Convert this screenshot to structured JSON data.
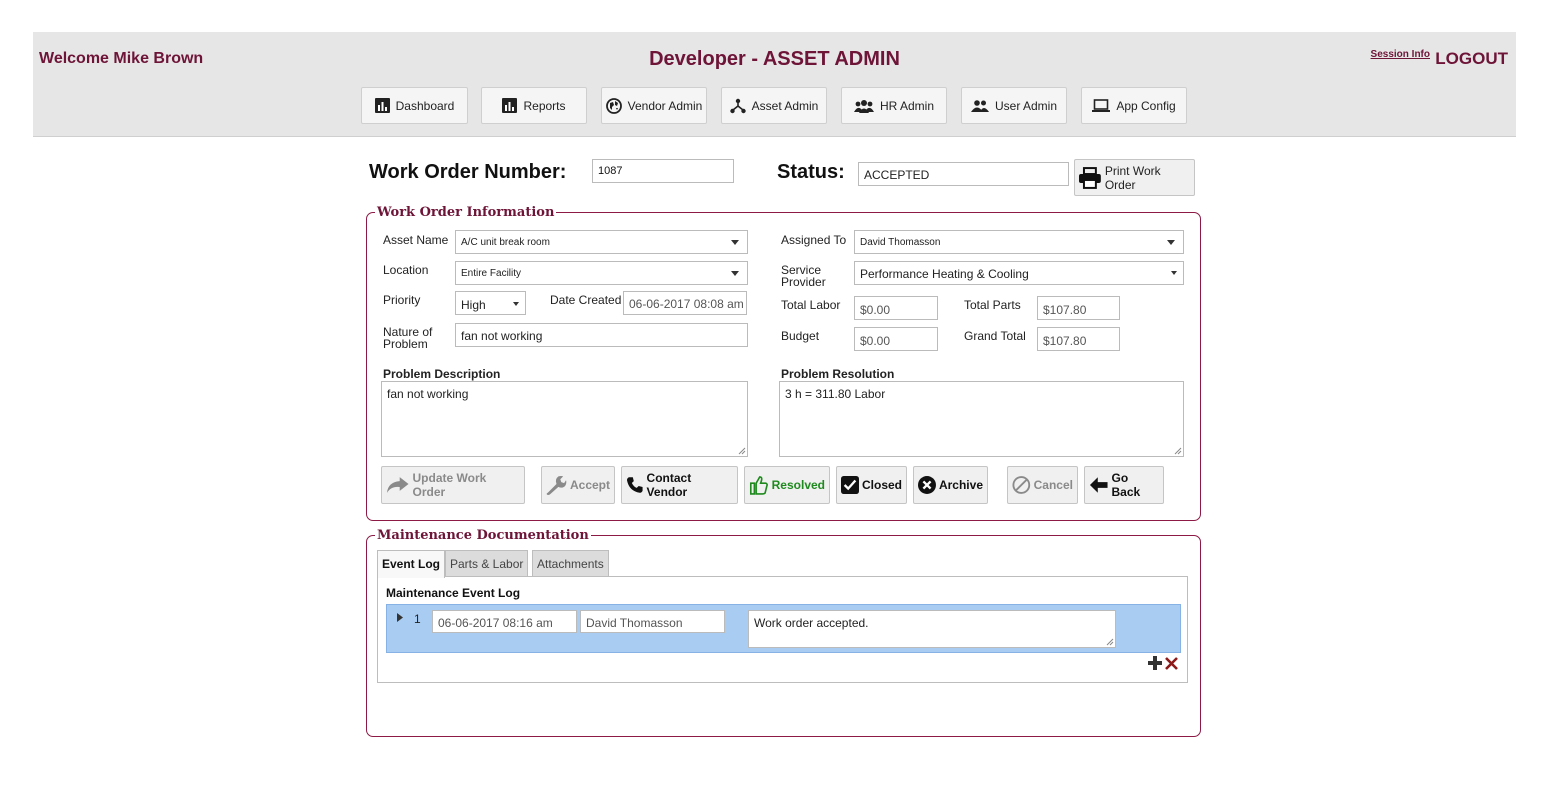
{
  "header": {
    "welcome": "Welcome Mike Brown",
    "title": "Developer - ASSET ADMIN",
    "session_info": "Session Info",
    "logout": "LOGOUT"
  },
  "nav": [
    {
      "label": "Dashboard",
      "icon": "bar-chart-icon"
    },
    {
      "label": "Reports",
      "icon": "bar-chart-icon"
    },
    {
      "label": "Vendor Admin",
      "icon": "globe-icon"
    },
    {
      "label": "Asset Admin",
      "icon": "network-icon"
    },
    {
      "label": "HR Admin",
      "icon": "users-group-icon"
    },
    {
      "label": "User Admin",
      "icon": "users-icon"
    },
    {
      "label": "App Config",
      "icon": "laptop-icon"
    }
  ],
  "work_order": {
    "number_label": "Work Order Number:",
    "number": "1087",
    "status_label": "Status:",
    "status": "ACCEPTED",
    "print_label": "Print Work Order"
  },
  "info": {
    "legend": "Work Order Information",
    "asset_name_label": "Asset Name",
    "asset_name": "A/C unit break room",
    "location_label": "Location",
    "location": "Entire Facility",
    "priority_label": "Priority",
    "priority": "High",
    "date_created_label": "Date Created",
    "date_created": "06-06-2017 08:08 am",
    "nature_label_1": "Nature of",
    "nature_label_2": "Problem",
    "nature": "fan not working",
    "assigned_to_label": "Assigned To",
    "assigned_to": "David Thomasson",
    "service_provider_label_1": "Service",
    "service_provider_label_2": "Provider",
    "service_provider": "Performance Heating & Cooling",
    "total_labor_label": "Total Labor",
    "total_labor": "$0.00",
    "total_parts_label": "Total Parts",
    "total_parts": "$107.80",
    "budget_label": "Budget",
    "budget": "$0.00",
    "grand_total_label": "Grand Total",
    "grand_total": "$107.80",
    "problem_description_label": "Problem Description",
    "problem_description": "fan not working",
    "problem_resolution_label": "Problem Resolution",
    "problem_resolution": "3 h = 311.80 Labor"
  },
  "actions": {
    "update": "Update Work Order",
    "accept": "Accept",
    "contact_vendor": "Contact Vendor",
    "resolved": "Resolved",
    "closed": "Closed",
    "archive": "Archive",
    "cancel": "Cancel",
    "go_back": "Go Back"
  },
  "maintenance": {
    "legend": "Maintenance Documentation",
    "tabs": [
      "Event Log",
      "Parts & Labor",
      "Attachments"
    ],
    "log_title": "Maintenance Event Log",
    "rows": [
      {
        "num": "1",
        "date": "06-06-2017 08:16 am",
        "person": "David Thomasson",
        "note": "Work order accepted."
      }
    ]
  },
  "colors": {
    "brand": "#6d1437",
    "border_accent": "#8c1a45",
    "header_bg": "#e6e6e6",
    "row_highlight": "#a9ccf3",
    "resolved_green": "#1e8a1e"
  }
}
